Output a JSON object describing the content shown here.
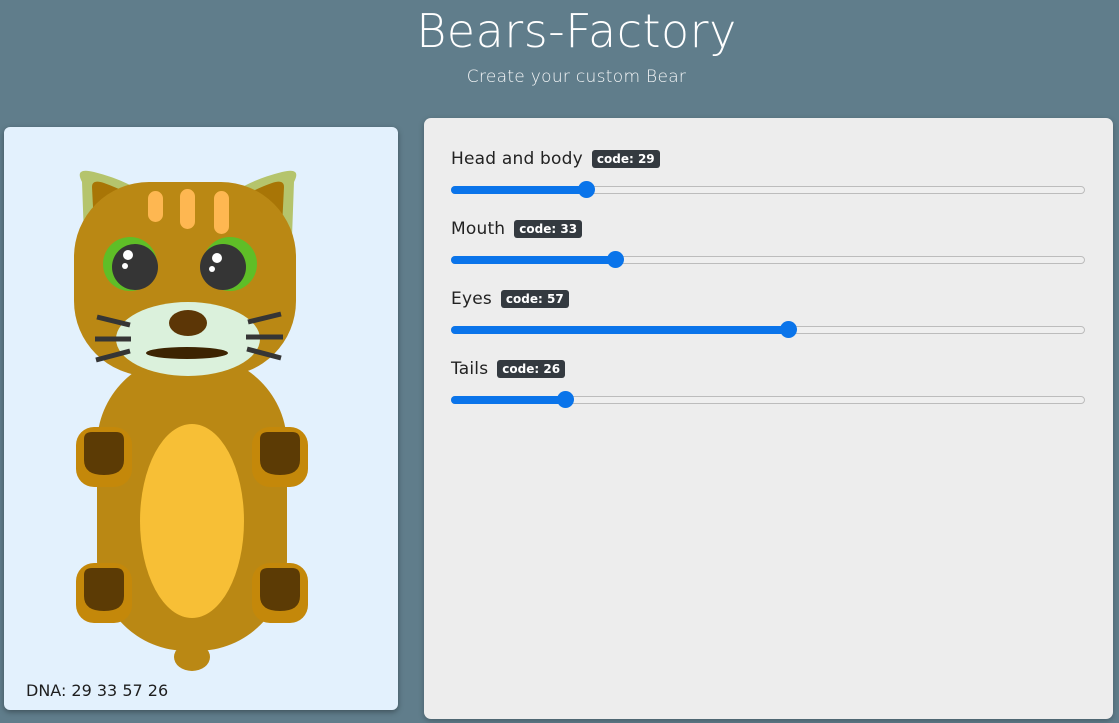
{
  "header": {
    "title": "Bears-Factory",
    "subtitle": "Create your custom Bear"
  },
  "bear": {
    "dna_text": "DNA: 29 33 57 26",
    "colors": {
      "background": "#e3f1fd",
      "body": "#ba8814",
      "belly": "#f7bf36",
      "ear_outer": "#b5c46c",
      "ear_inner": "#a87506",
      "stripes": "#feb751",
      "eye_ring": "#5fbe27",
      "eye_pupil": "#353535",
      "muzzle": "#dbf1dc",
      "nose": "#5c3606",
      "mouth": "#3d2402",
      "whiskers": "#353535",
      "paw_outer": "#c4880a",
      "paw_inner": "#5c3b05",
      "tail": "#ba8814"
    }
  },
  "controls": [
    {
      "label": "Head and body",
      "badge": "code: 29",
      "value": 29,
      "min": 10,
      "max": 98
    },
    {
      "label": "Mouth",
      "badge": "code: 33",
      "value": 33,
      "min": 10,
      "max": 98
    },
    {
      "label": "Eyes",
      "badge": "code: 57",
      "value": 57,
      "min": 10,
      "max": 98
    },
    {
      "label": "Tails",
      "badge": "code: 26",
      "value": 26,
      "min": 10,
      "max": 98
    }
  ],
  "ui_colors": {
    "page_background": "#607d8b",
    "panel_background": "#ededed",
    "slider_accent": "#0a74ea",
    "badge_background": "#343a40"
  }
}
